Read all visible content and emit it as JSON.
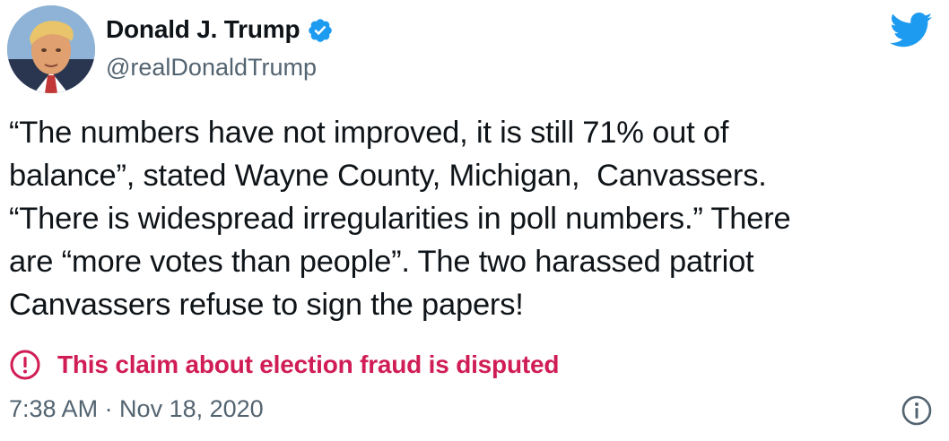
{
  "author": {
    "display_name": "Donald J. Trump",
    "handle": "@realDonaldTrump",
    "verified": true,
    "avatar_icon": "profile-photo"
  },
  "brand": {
    "icon": "twitter-bird-icon",
    "color": "#1d9bf0"
  },
  "tweet": {
    "lines": [
      "“The numbers have not improved, it is still 71% out of",
      "balance”, stated Wayne County, Michigan,  Canvassers.",
      "“There is widespread irregularities in poll numbers.” There",
      "are “more votes than people”. The two harassed patriot",
      "Canvassers refuse to sign the papers!"
    ]
  },
  "label": {
    "icon": "alert-circle-icon",
    "text": "This claim about election fraud is disputed",
    "color": "#d01d55"
  },
  "meta": {
    "timestamp": "7:38 AM · Nov 18, 2020",
    "info_icon": "info-icon"
  }
}
